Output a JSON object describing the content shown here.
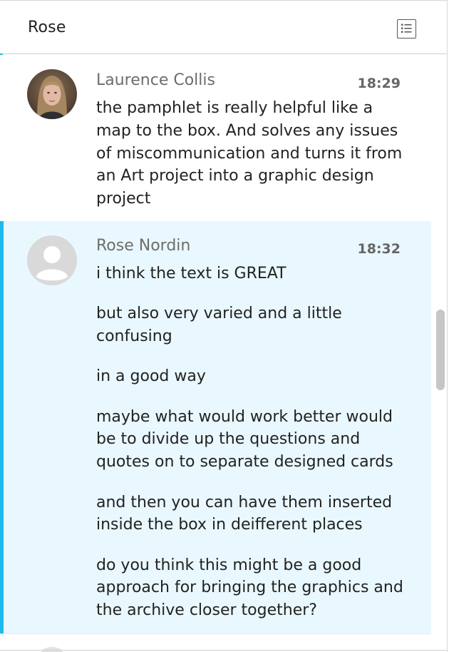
{
  "header": {
    "title": "Rose",
    "list_icon": "list-view-icon"
  },
  "messages": [
    {
      "author": "Laurence Collis",
      "time": "18:29",
      "avatar": "user-photo",
      "paragraphs": [
        "the pamphlet is really helpful like a map to the box. And solves any issues of miscommunication and turns it from an Art project into a graphic design project"
      ]
    },
    {
      "author": "Rose Nordin",
      "time": "18:32",
      "avatar": "default-user-icon",
      "highlighted": true,
      "paragraphs": [
        "i think the text is GREAT",
        "but also very varied and a little confusing",
        "in a good way",
        "maybe what would work better would be to divide up the questions and quotes on to separate designed cards",
        "and then you can have them inserted inside the box in deifferent places",
        "do you think this might be a good approach for bringing the graphics and the archive closer together?"
      ]
    }
  ],
  "colors": {
    "accent": "#21b8ee",
    "highlight_bg": "#e9f8fe"
  }
}
